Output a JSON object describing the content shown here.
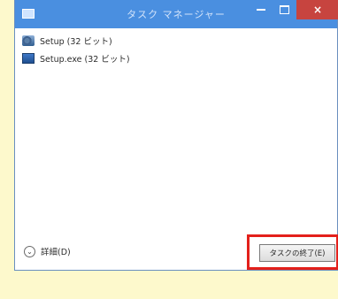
{
  "window": {
    "title": "タスク マネージャー",
    "close_glyph": "×",
    "colors": {
      "titlebar": "#4a8fe0",
      "close_button": "#c7443f",
      "highlight": "#e3201b",
      "background": "#fdf9cc"
    }
  },
  "process_list": {
    "items": [
      {
        "label": "Setup (32 ビット)",
        "icon": "setup-icon"
      },
      {
        "label": "Setup.exe (32 ビット)",
        "icon": "exe-icon"
      }
    ]
  },
  "footer": {
    "details_label": "詳細(D)",
    "details_icon": "chevron-down-icon",
    "chevron_glyph": "⌄",
    "end_task_label": "タスクの終了(E)"
  }
}
